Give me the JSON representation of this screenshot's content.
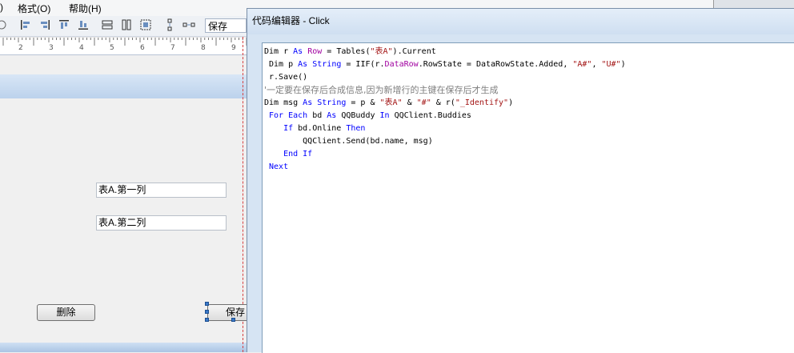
{
  "menu": {
    "format": "格式(O)",
    "help": "帮助(H)"
  },
  "toolbar": {
    "select_value": "保存"
  },
  "ruler": {
    "ticks": [
      "2",
      "3",
      "4",
      "5",
      "6",
      "7",
      "8",
      "9"
    ]
  },
  "form": {
    "field1": "表A.第一列",
    "field2": "表A.第二列",
    "delete_button": "删除",
    "save_button": "保存"
  },
  "editor": {
    "title": "代码编辑器 - Click",
    "code": {
      "l1": {
        "a": "Dim r ",
        "b": "As",
        "c": " ",
        "d": "Row",
        "e": " = Tables(",
        "f": "\"表A\"",
        "g": ").Current"
      },
      "l2": {
        "a": " Dim p ",
        "b": "As",
        "c": " ",
        "d": "String",
        "e": " = IIF(r.",
        "f": "DataRow",
        "g": ".RowState = DataRowState.Added, ",
        "h": "\"A#\"",
        "i": ", ",
        "j": "\"U#\"",
        "k": ")"
      },
      "l3": {
        "a": " r.Save()"
      },
      "l4": {
        "a": "'一定要在保存后合成信息,因为新增行的主键在保存后才生成"
      },
      "l5": {
        "a": "Dim msg ",
        "b": "As",
        "c": " ",
        "d": "String",
        "e": " = p & ",
        "f": "\"表A\"",
        "g": " & ",
        "h": "\"#\"",
        "i": " & r(",
        "j": "\"_Identify\"",
        "k": ")"
      },
      "l6": {
        "a": " For Each",
        "b": " bd ",
        "c": "As",
        "d": " QQBuddy ",
        "e": "In",
        "f": " QQClient.Buddies"
      },
      "l7": {
        "a": "    If",
        "b": " bd.Online ",
        "c": "Then"
      },
      "l8": {
        "a": "        QQClient.Send(bd.name, msg)"
      },
      "l9": {
        "a": "    End If"
      },
      "l10": {
        "a": " Next"
      }
    }
  }
}
